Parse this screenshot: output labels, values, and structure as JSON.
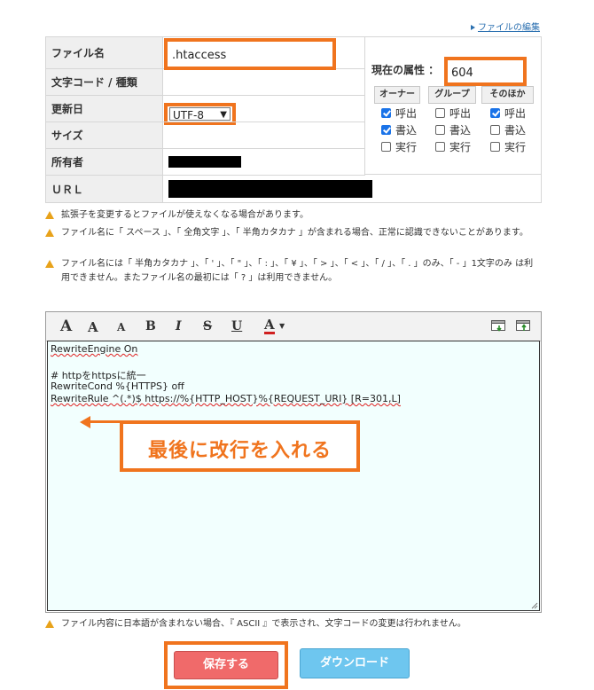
{
  "header": {
    "edit_link": "ファイルの編集"
  },
  "file_info": {
    "rows": [
      {
        "label": "ファイル名"
      },
      {
        "label": "文字コード / 種類"
      },
      {
        "label": "更新日"
      },
      {
        "label": "サイズ"
      },
      {
        "label": "所有者"
      },
      {
        "label": "ＵＲＬ"
      }
    ],
    "filename_value": ".htaccess",
    "encoding_value": "UTF-8"
  },
  "permissions": {
    "label": "現在の属性 ：",
    "value": "604",
    "groups": [
      "オーナー",
      "グループ",
      "そのほか"
    ],
    "rows": [
      "呼出",
      "書込",
      "実行"
    ],
    "checked": [
      [
        true,
        true,
        false
      ],
      [
        false,
        false,
        false
      ],
      [
        true,
        false,
        false
      ]
    ]
  },
  "warnings": [
    "拡張子を変更するとファイルが使えなくなる場合があります。",
    "ファイル名に「 スペース 」、「 全角文字 」、「 半角カタカナ 」が含まれる場合、正常に認識できないことがあります。",
    "ファイル名には「 半角カタカナ 」、「 ' 」、「 \" 」、「 : 」、「 ¥ 」、「 > 」、「 < 」、「 / 」、「 . 」のみ、「 - 」1文字のみ は利用できません。またファイル名の最初には「 ? 」は利用できません。"
  ],
  "toolbar": {
    "buttons": [
      "A",
      "A",
      "A",
      "B",
      "I",
      "S",
      "U",
      "A"
    ]
  },
  "editor": {
    "lines": [
      "RewriteEngine On",
      "",
      "# httpをhttpsに統一",
      "RewriteCond %{HTTPS} off",
      "RewriteRule ^(.*)$ https://%{HTTP_HOST}%{REQUEST_URI} [R=301,L]"
    ]
  },
  "annotation": {
    "callout_text": "最後に改行を入れる"
  },
  "footer_note": "ファイル内容に日本語が含まれない場合、『 ASCII 』で表示され、文字コードの変更は行われません。",
  "actions": {
    "save": "保存する",
    "download": "ダウンロード"
  },
  "colors": {
    "highlight": "#f0741e",
    "save": "#f06a6a",
    "download": "#6ec6ef",
    "editor_bg": "#f2fffe"
  }
}
